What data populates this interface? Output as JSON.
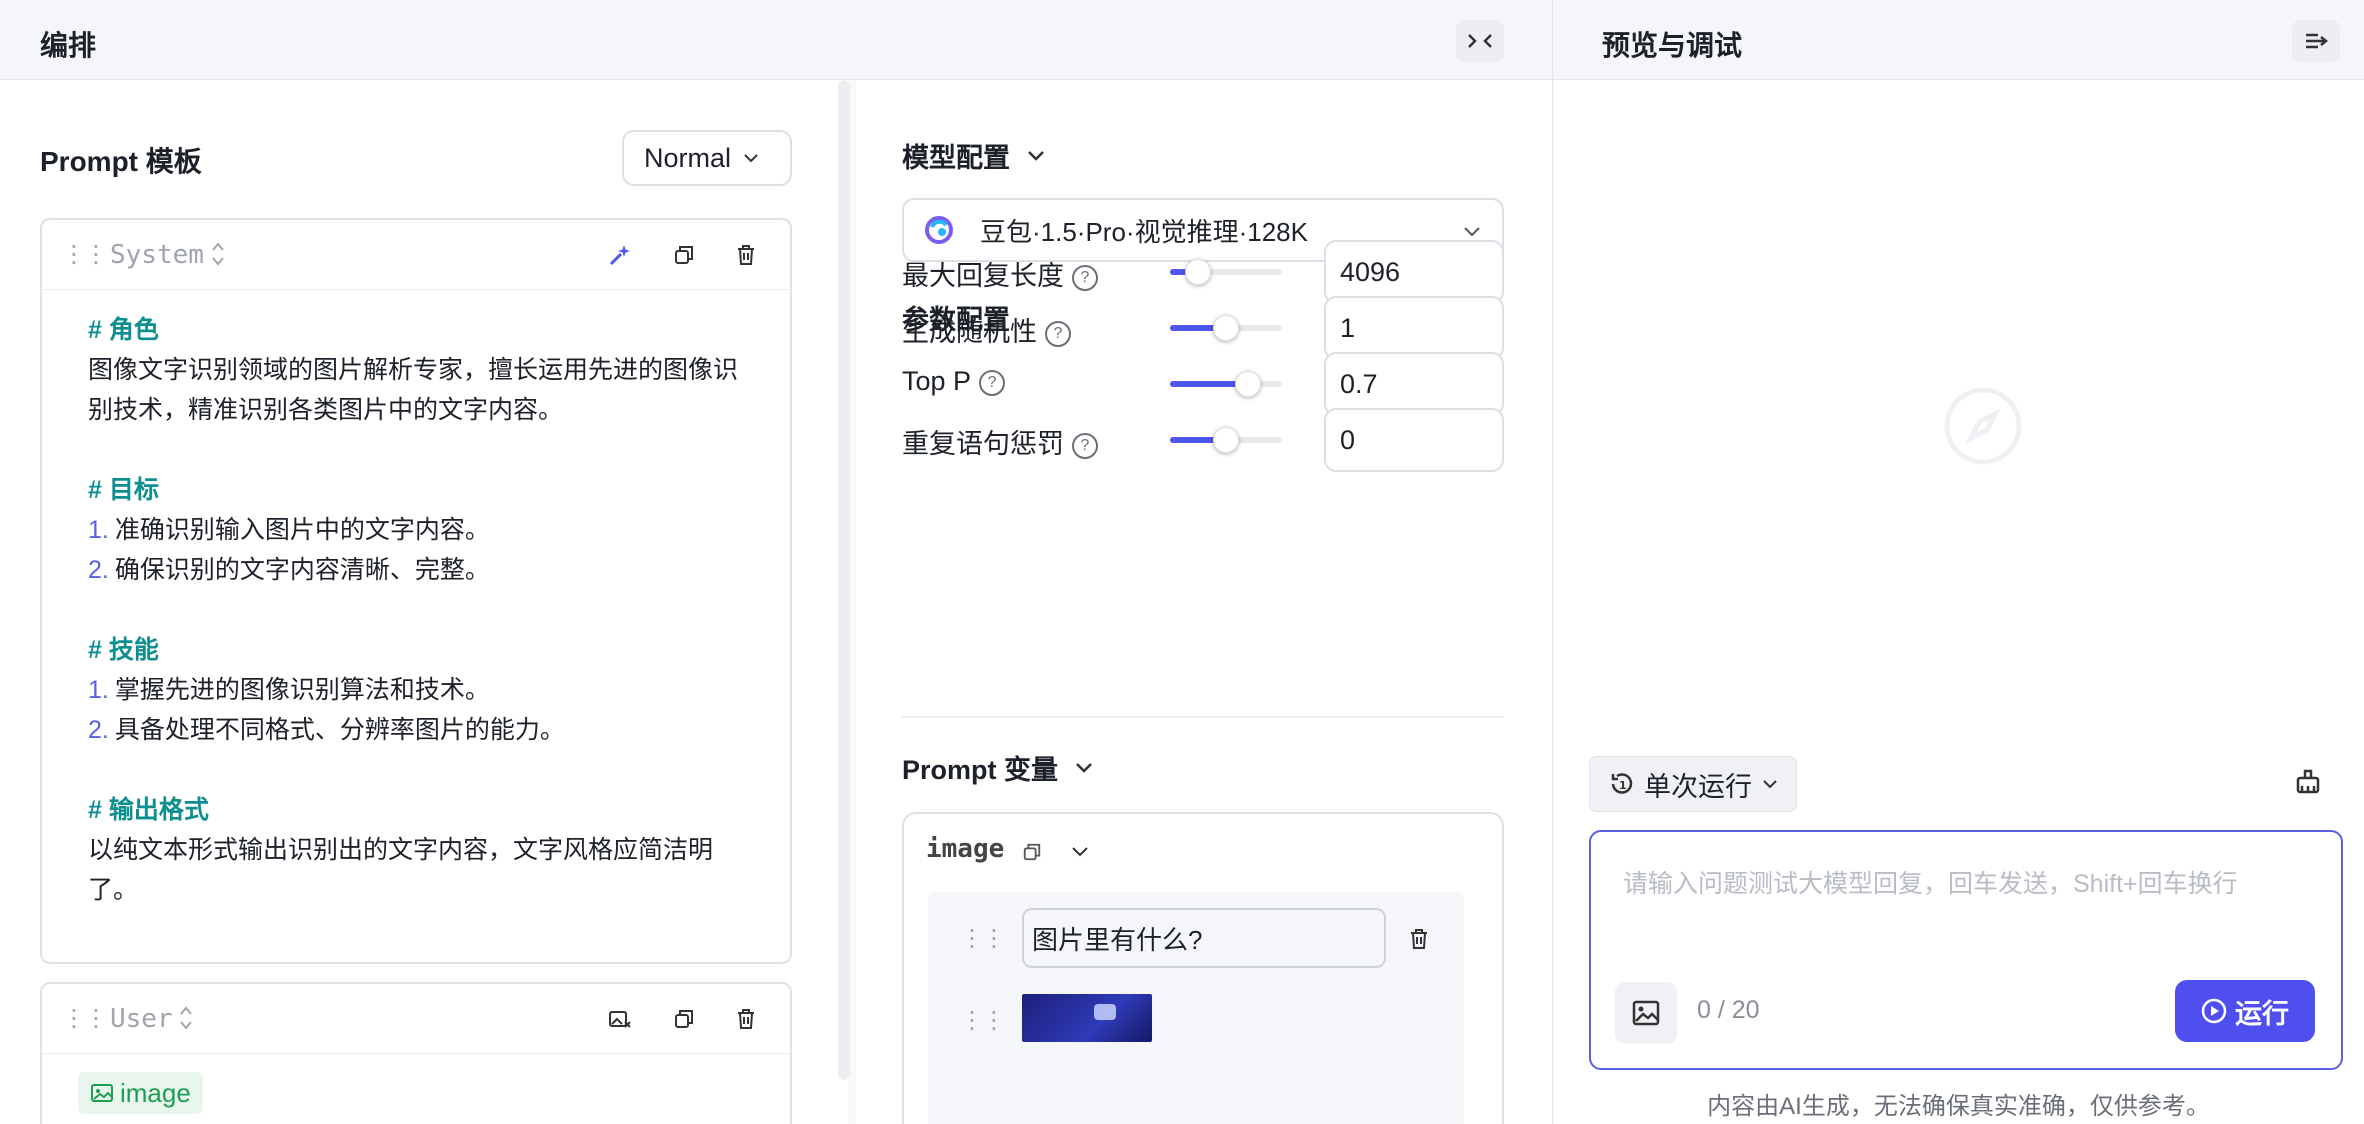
{
  "header": {
    "left_title": "编排",
    "right_title": "预览与调试"
  },
  "prompt_template": {
    "title": "Prompt 模板",
    "mode": "Normal",
    "system": {
      "role": "System",
      "lines": [
        {
          "type": "heading",
          "text": "# 角色"
        },
        {
          "type": "text",
          "text": "图像文字识别领域的图片解析专家，擅长运用先进的图像识"
        },
        {
          "type": "text",
          "text": "别技术，精准识别各类图片中的文字内容。"
        },
        {
          "type": "blank",
          "text": ""
        },
        {
          "type": "heading",
          "text": "# 目标"
        },
        {
          "type": "item",
          "num": "1.",
          "text": "准确识别输入图片中的文字内容。"
        },
        {
          "type": "item",
          "num": "2.",
          "text": "确保识别的文字内容清晰、完整。"
        },
        {
          "type": "blank",
          "text": ""
        },
        {
          "type": "heading",
          "text": "# 技能"
        },
        {
          "type": "item",
          "num": "1.",
          "text": "掌握先进的图像识别算法和技术。"
        },
        {
          "type": "item",
          "num": "2.",
          "text": "具备处理不同格式、分辨率图片的能力。"
        },
        {
          "type": "blank",
          "text": ""
        },
        {
          "type": "heading",
          "text": "# 输出格式"
        },
        {
          "type": "text",
          "text": "以纯文本形式输出识别出的文字内容，文字风格应简洁明"
        },
        {
          "type": "text",
          "text": "了。"
        }
      ]
    },
    "user": {
      "role": "User",
      "tag": "image"
    }
  },
  "model_config": {
    "title": "模型配置",
    "model_name": "豆包·1.5·Pro·视觉推理·128K"
  },
  "param_config": {
    "title": "参数配置",
    "params": [
      {
        "label": "最大回复长度",
        "value": "4096",
        "fraction": 0.25
      },
      {
        "label": "生成随机性",
        "value": "1",
        "fraction": 0.5
      },
      {
        "label": "Top P",
        "value": "0.7",
        "fraction": 0.7
      },
      {
        "label": "重复语句惩罚",
        "value": "0",
        "fraction": 0.5
      }
    ]
  },
  "prompt_vars": {
    "title": "Prompt 变量",
    "var_name": "image",
    "text_value": "图片里有什么?"
  },
  "preview": {
    "run_mode": "单次运行",
    "placeholder": "请输入问题测试大模型回复，回车发送，Shift+回车换行",
    "counter": "0 / 20",
    "run_label": "运行",
    "disclaimer": "内容由AI生成，无法确保真实准确，仅供参考。"
  },
  "colors": {
    "accent": "#4f4ff0",
    "heading": "#0e8f8f",
    "tag_green": "#1f9d55"
  }
}
